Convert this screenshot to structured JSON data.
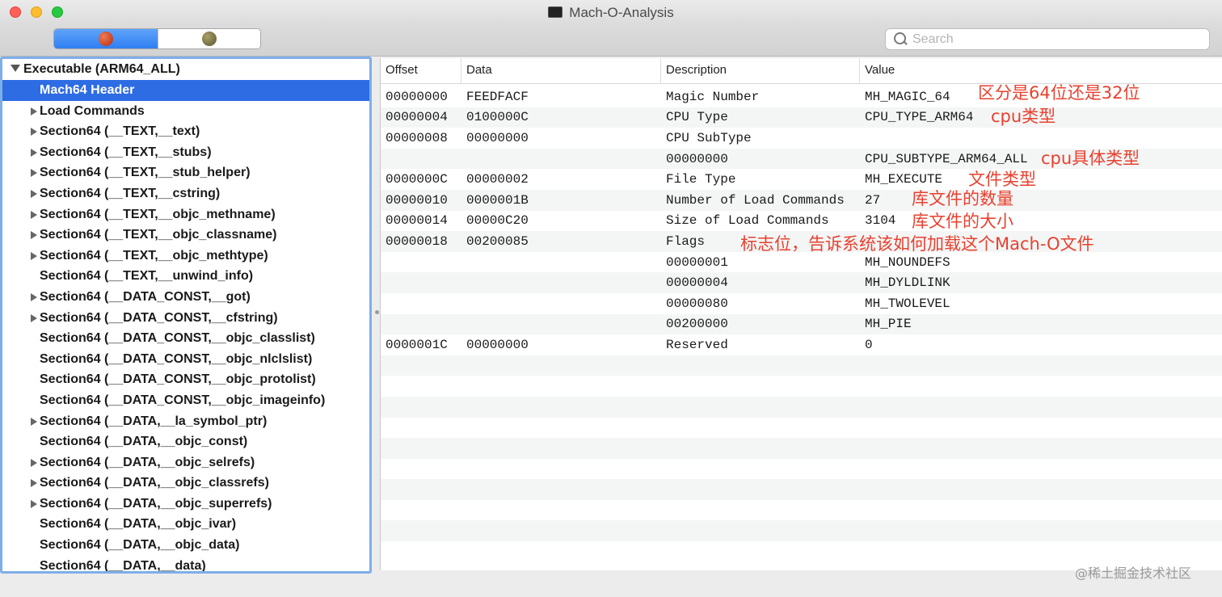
{
  "window": {
    "title": "Mach-O-Analysis"
  },
  "toolbar": {
    "segment_left_icon": "red-apple-icon",
    "segment_right_icon": "olive-apple-icon",
    "search_placeholder": "Search"
  },
  "sidebar": {
    "root_label": "Executable  (ARM64_ALL)",
    "items": [
      {
        "label": "Mach64 Header",
        "expandable": false,
        "selected": true
      },
      {
        "label": "Load Commands",
        "expandable": true
      },
      {
        "label": "Section64 (__TEXT,__text)",
        "expandable": true
      },
      {
        "label": "Section64 (__TEXT,__stubs)",
        "expandable": true
      },
      {
        "label": "Section64 (__TEXT,__stub_helper)",
        "expandable": true
      },
      {
        "label": "Section64 (__TEXT,__cstring)",
        "expandable": true
      },
      {
        "label": "Section64 (__TEXT,__objc_methname)",
        "expandable": true
      },
      {
        "label": "Section64 (__TEXT,__objc_classname)",
        "expandable": true
      },
      {
        "label": "Section64 (__TEXT,__objc_methtype)",
        "expandable": true
      },
      {
        "label": "Section64 (__TEXT,__unwind_info)",
        "expandable": false
      },
      {
        "label": "Section64 (__DATA_CONST,__got)",
        "expandable": true
      },
      {
        "label": "Section64 (__DATA_CONST,__cfstring)",
        "expandable": true
      },
      {
        "label": "Section64 (__DATA_CONST,__objc_classlist)",
        "expandable": false
      },
      {
        "label": "Section64 (__DATA_CONST,__objc_nlclslist)",
        "expandable": false
      },
      {
        "label": "Section64 (__DATA_CONST,__objc_protolist)",
        "expandable": false
      },
      {
        "label": "Section64 (__DATA_CONST,__objc_imageinfo)",
        "expandable": false
      },
      {
        "label": "Section64 (__DATA,__la_symbol_ptr)",
        "expandable": true
      },
      {
        "label": "Section64 (__DATA,__objc_const)",
        "expandable": false
      },
      {
        "label": "Section64 (__DATA,__objc_selrefs)",
        "expandable": true
      },
      {
        "label": "Section64 (__DATA,__objc_classrefs)",
        "expandable": true
      },
      {
        "label": "Section64 (__DATA,__objc_superrefs)",
        "expandable": true
      },
      {
        "label": "Section64 (__DATA,__objc_ivar)",
        "expandable": false
      },
      {
        "label": "Section64 (__DATA,__objc_data)",
        "expandable": false
      },
      {
        "label": "Section64 (__DATA,__data)",
        "expandable": false
      }
    ]
  },
  "table": {
    "columns": [
      "Offset",
      "Data",
      "Description",
      "Value"
    ],
    "rows": [
      [
        "00000000",
        "FEEDFACF",
        "Magic Number",
        "MH_MAGIC_64"
      ],
      [
        "00000004",
        "0100000C",
        "CPU Type",
        "CPU_TYPE_ARM64"
      ],
      [
        "00000008",
        "00000000",
        "CPU SubType",
        ""
      ],
      [
        "",
        "",
        "00000000",
        "CPU_SUBTYPE_ARM64_ALL"
      ],
      [
        "0000000C",
        "00000002",
        "File Type",
        "MH_EXECUTE"
      ],
      [
        "00000010",
        "0000001B",
        "Number of Load Commands",
        "27"
      ],
      [
        "00000014",
        "00000C20",
        "Size of Load Commands",
        "3104"
      ],
      [
        "00000018",
        "00200085",
        "Flags",
        ""
      ],
      [
        "",
        "",
        "00000001",
        "MH_NOUNDEFS"
      ],
      [
        "",
        "",
        "00000004",
        "MH_DYLDLINK"
      ],
      [
        "",
        "",
        "00000080",
        "MH_TWOLEVEL"
      ],
      [
        "",
        "",
        "00200000",
        "MH_PIE"
      ],
      [
        "0000001C",
        "00000000",
        "Reserved",
        "0"
      ]
    ]
  },
  "annotations": {
    "magic": "区分是64位还是32位",
    "cpu_type": "cpu类型",
    "cpu_subtype": "cpu具体类型",
    "file_type": "文件类型",
    "ncmds": "库文件的数量",
    "sizeofcmds": "库文件的大小",
    "flags": "标志位，告诉系统该如何加载这个Mach-O文件",
    "color": "#e8412f"
  },
  "watermark": "@稀土掘金技术社区"
}
